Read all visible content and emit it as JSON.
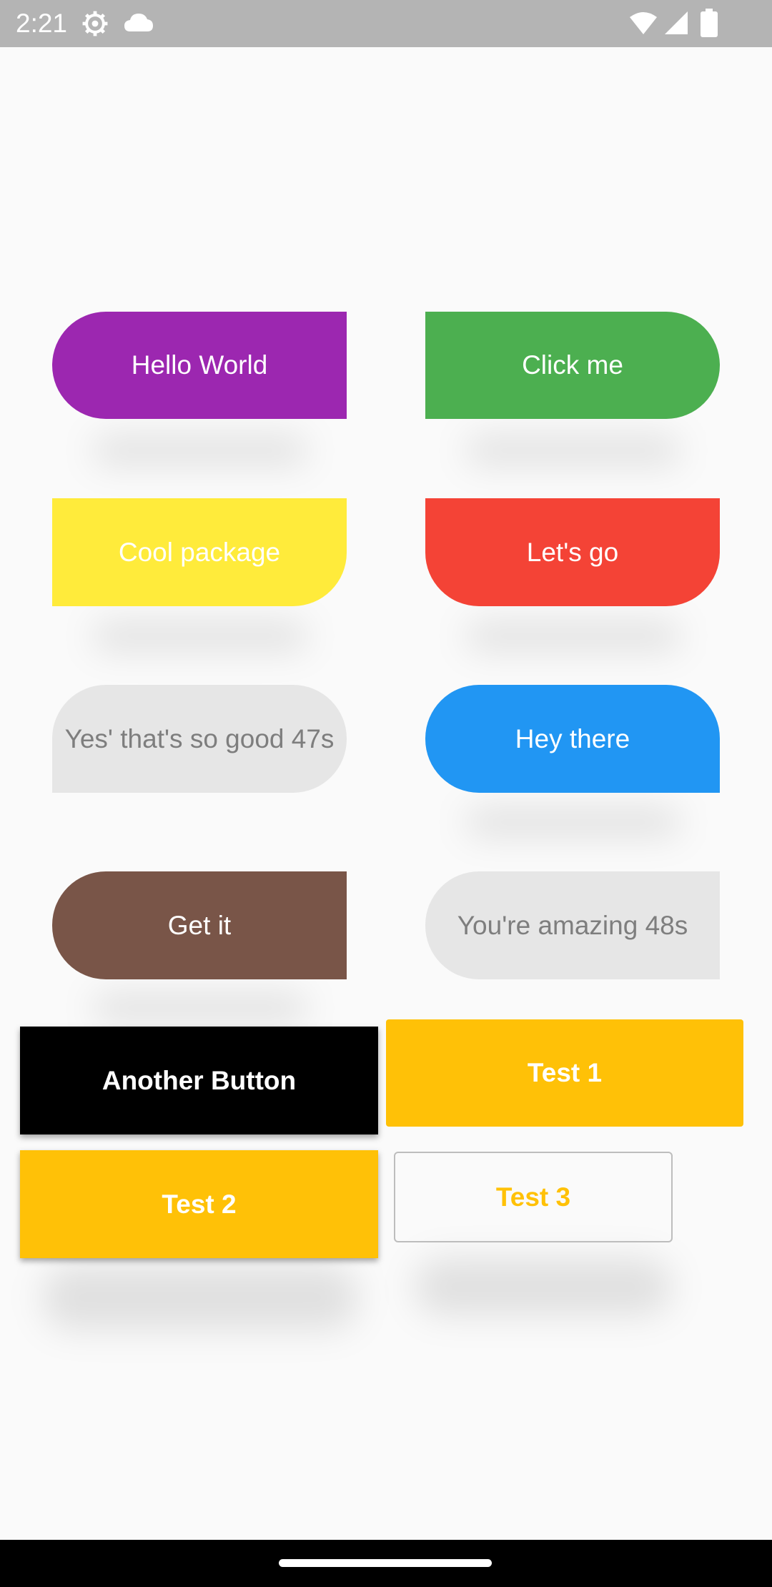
{
  "status_bar": {
    "time": "2:21",
    "icons": [
      "settings-gear-icon",
      "cloud-icon",
      "wifi-icon",
      "cellular-signal-icon",
      "battery-icon"
    ]
  },
  "colors": {
    "status_bar_bg": "#b4b4b4",
    "background": "#fafafa",
    "purple": "#9c27b0",
    "green": "#4caf50",
    "yellow": "#ffeb3b",
    "red": "#f44336",
    "light_gray": "#e6e6e6",
    "blue": "#2196f3",
    "brown": "#795548",
    "black": "#000000",
    "amber": "#ffc107",
    "nav_bar": "#000000"
  },
  "buttons": {
    "hello_world": "Hello World",
    "click_me": "Click me",
    "cool_package": "Cool package",
    "lets_go": "Let's go",
    "yes_thats_so_good": "Yes' that's so good 47s",
    "hey_there": "Hey there",
    "get_it": "Get it",
    "youre_amazing": "You're amazing 48s",
    "another_button": "Another Button",
    "test_1": "Test 1",
    "test_2": "Test 2",
    "test_3": "Test 3"
  }
}
